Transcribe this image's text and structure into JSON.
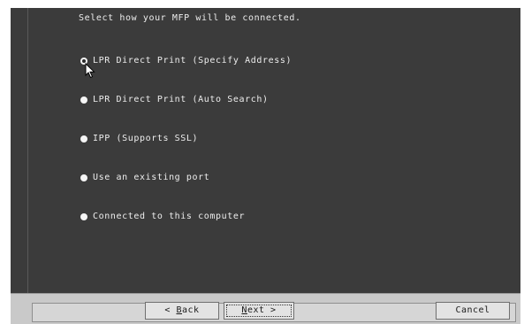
{
  "instruction": "Select how your MFP will be connected.",
  "options": [
    {
      "label": "LPR Direct Print (Specify Address)",
      "selected": true
    },
    {
      "label": "LPR Direct Print (Auto Search)",
      "selected": false
    },
    {
      "label": "IPP (Supports SSL)",
      "selected": false
    },
    {
      "label": "Use an existing port",
      "selected": false
    },
    {
      "label": "Connected to this computer",
      "selected": false
    }
  ],
  "buttons": {
    "back_prefix": "< ",
    "back_key": "B",
    "back_rest": "ack",
    "next_key": "N",
    "next_rest": "ext >",
    "cancel": "Cancel"
  },
  "icons": {
    "cursor": "arrow-cursor-icon"
  },
  "colors": {
    "panel": "#3b3b3b",
    "text": "#ededed",
    "bar": "#c9c9c9"
  }
}
